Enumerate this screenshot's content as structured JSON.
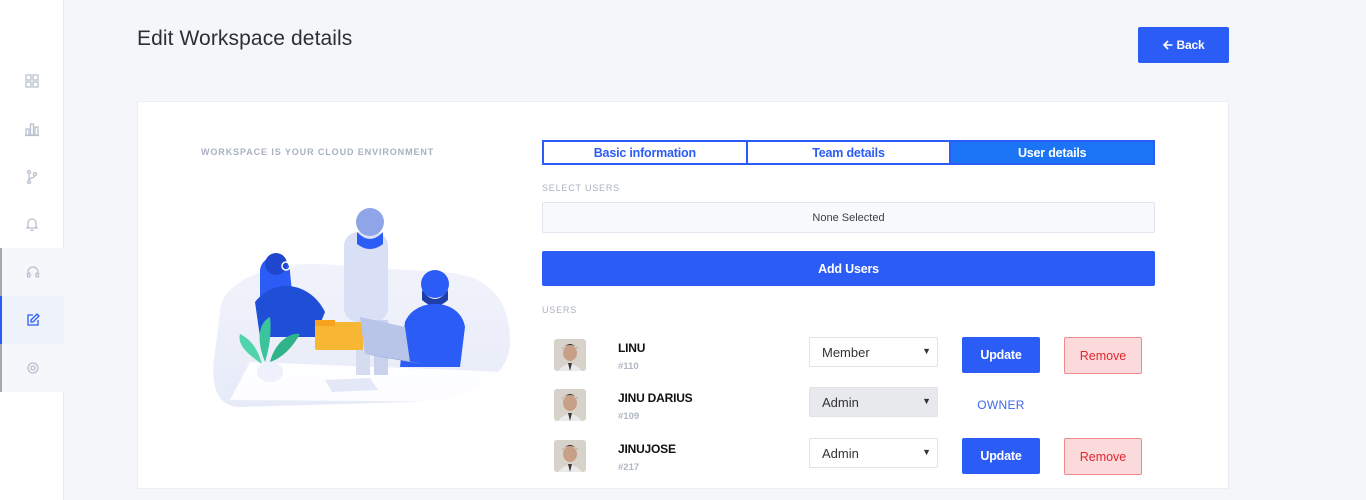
{
  "sidebar": {
    "items": [
      {
        "icon": "grid-icon"
      },
      {
        "icon": "bar-chart-icon"
      },
      {
        "icon": "git-branch-icon"
      },
      {
        "icon": "bell-icon"
      },
      {
        "icon": "headset-icon"
      },
      {
        "icon": "edit-icon"
      },
      {
        "icon": "settings-icon"
      }
    ]
  },
  "header": {
    "title": "Edit Workspace details",
    "back_label": "Back",
    "back_icon": "arrow-left-icon"
  },
  "illustration": {
    "caption": "WORKSPACE IS YOUR CLOUD ENVIRONMENT"
  },
  "tabs": [
    {
      "label": "Basic information",
      "active": false
    },
    {
      "label": "Team details",
      "active": false
    },
    {
      "label": "User details",
      "active": true
    }
  ],
  "select_users": {
    "label": "SELECT USERS",
    "value": "None Selected"
  },
  "add_users_label": "Add Users",
  "users_label": "USERS",
  "users": [
    {
      "name": "LINU",
      "id": "#110",
      "role": "Member",
      "update_label": "Update",
      "remove_label": "Remove"
    },
    {
      "name": "JINU DARIUS",
      "id": "#109",
      "role": "Admin",
      "owner_label": "OWNER"
    },
    {
      "name": "JINUJOSE",
      "id": "#217",
      "role": "Admin",
      "update_label": "Update",
      "remove_label": "Remove"
    }
  ],
  "colors": {
    "accent": "#2b5cf6",
    "tab_active": "#1a74f5",
    "remove_bg": "#fadadb",
    "remove_text": "#e3262f"
  }
}
